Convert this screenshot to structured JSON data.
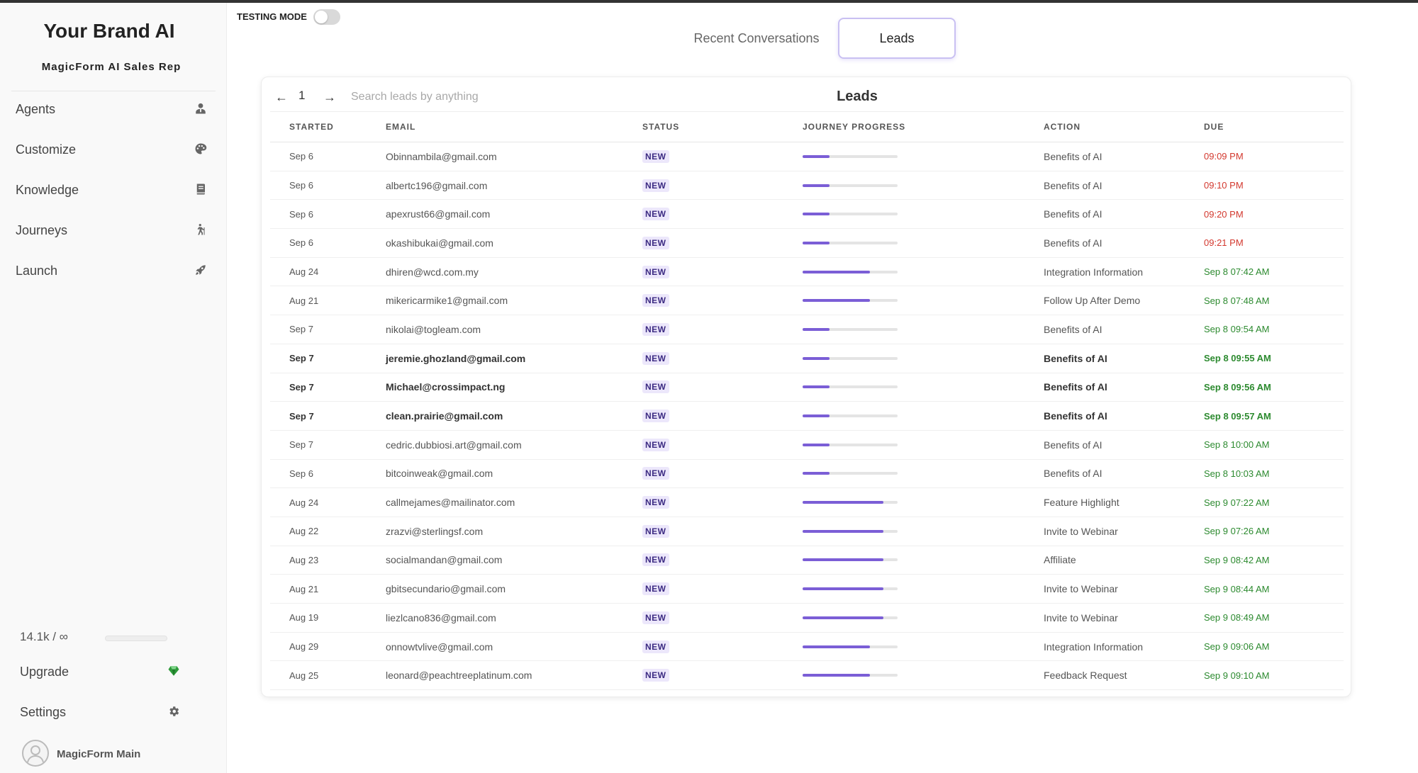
{
  "sidebar": {
    "brand": "Your Brand AI",
    "subbrand": "MagicForm AI Sales Rep",
    "nav": [
      {
        "label": "Agents",
        "icon": "person-icon"
      },
      {
        "label": "Customize",
        "icon": "palette-icon"
      },
      {
        "label": "Knowledge",
        "icon": "book-icon"
      },
      {
        "label": "Journeys",
        "icon": "hiking-icon"
      },
      {
        "label": "Launch",
        "icon": "rocket-icon"
      }
    ],
    "usage": "14.1k / ∞",
    "usage_fraction": 0.0,
    "upgrade_label": "Upgrade",
    "settings_label": "Settings",
    "account_name": "MagicForm Main"
  },
  "header": {
    "testing_mode_label": "TESTING MODE",
    "testing_mode_on": false,
    "tabs": [
      {
        "label": "Recent Conversations",
        "active": false
      },
      {
        "label": "Leads",
        "active": true
      }
    ]
  },
  "leads": {
    "title": "Leads",
    "page": "1",
    "prev_glyph": "←",
    "next_glyph": "→",
    "search_placeholder": "Search leads by anything",
    "columns": [
      "STARTED",
      "EMAIL",
      "STATUS",
      "JOURNEY PROGRESS",
      "ACTION",
      "DUE"
    ],
    "rows": [
      {
        "started": "Sep 6",
        "email": "Obinnambila@gmail.com",
        "status": "NEW",
        "progress": 0.28,
        "action": "Benefits of AI",
        "due": "09:09 PM",
        "due_state": "overdue",
        "bold": false
      },
      {
        "started": "Sep 6",
        "email": "albertc196@gmail.com",
        "status": "NEW",
        "progress": 0.28,
        "action": "Benefits of AI",
        "due": "09:10 PM",
        "due_state": "overdue",
        "bold": false
      },
      {
        "started": "Sep 6",
        "email": "apexrust66@gmail.com",
        "status": "NEW",
        "progress": 0.28,
        "action": "Benefits of AI",
        "due": "09:20 PM",
        "due_state": "overdue",
        "bold": false
      },
      {
        "started": "Sep 6",
        "email": "okashibukai@gmail.com",
        "status": "NEW",
        "progress": 0.28,
        "action": "Benefits of AI",
        "due": "09:21 PM",
        "due_state": "overdue",
        "bold": false
      },
      {
        "started": "Aug 24",
        "email": "dhiren@wcd.com.my",
        "status": "NEW",
        "progress": 0.71,
        "action": "Integration Information",
        "due": "Sep 8 07:42 AM",
        "due_state": "upcoming",
        "bold": false
      },
      {
        "started": "Aug 21",
        "email": "mikericarmike1@gmail.com",
        "status": "NEW",
        "progress": 0.71,
        "action": "Follow Up After Demo",
        "due": "Sep 8 07:48 AM",
        "due_state": "upcoming",
        "bold": false
      },
      {
        "started": "Sep 7",
        "email": "nikolai@togleam.com",
        "status": "NEW",
        "progress": 0.28,
        "action": "Benefits of AI",
        "due": "Sep 8 09:54 AM",
        "due_state": "upcoming",
        "bold": false
      },
      {
        "started": "Sep 7",
        "email": "jeremie.ghozland@gmail.com",
        "status": "NEW",
        "progress": 0.28,
        "action": "Benefits of AI",
        "due": "Sep 8 09:55 AM",
        "due_state": "upcoming",
        "bold": true
      },
      {
        "started": "Sep 7",
        "email": "Michael@crossimpact.ng",
        "status": "NEW",
        "progress": 0.28,
        "action": "Benefits of AI",
        "due": "Sep 8 09:56 AM",
        "due_state": "upcoming",
        "bold": true
      },
      {
        "started": "Sep 7",
        "email": "clean.prairie@gmail.com",
        "status": "NEW",
        "progress": 0.28,
        "action": "Benefits of AI",
        "due": "Sep 8 09:57 AM",
        "due_state": "upcoming",
        "bold": true
      },
      {
        "started": "Sep 7",
        "email": "cedric.dubbiosi.art@gmail.com",
        "status": "NEW",
        "progress": 0.28,
        "action": "Benefits of AI",
        "due": "Sep 8 10:00 AM",
        "due_state": "upcoming",
        "bold": false
      },
      {
        "started": "Sep 6",
        "email": "bitcoinweak@gmail.com",
        "status": "NEW",
        "progress": 0.28,
        "action": "Benefits of AI",
        "due": "Sep 8 10:03 AM",
        "due_state": "upcoming",
        "bold": false
      },
      {
        "started": "Aug 24",
        "email": "callmejames@mailinator.com",
        "status": "NEW",
        "progress": 0.85,
        "action": "Feature Highlight",
        "due": "Sep 9 07:22 AM",
        "due_state": "upcoming",
        "bold": false
      },
      {
        "started": "Aug 22",
        "email": "zrazvi@sterlingsf.com",
        "status": "NEW",
        "progress": 0.85,
        "action": "Invite to Webinar",
        "due": "Sep 9 07:26 AM",
        "due_state": "upcoming",
        "bold": false
      },
      {
        "started": "Aug 23",
        "email": "socialmandan@gmail.com",
        "status": "NEW",
        "progress": 0.85,
        "action": "Affiliate",
        "due": "Sep 9 08:42 AM",
        "due_state": "upcoming",
        "bold": false
      },
      {
        "started": "Aug 21",
        "email": "gbitsecundario@gmail.com",
        "status": "NEW",
        "progress": 0.85,
        "action": "Invite to Webinar",
        "due": "Sep 9 08:44 AM",
        "due_state": "upcoming",
        "bold": false
      },
      {
        "started": "Aug 19",
        "email": "liezlcano836@gmail.com",
        "status": "NEW",
        "progress": 0.85,
        "action": "Invite to Webinar",
        "due": "Sep 9 08:49 AM",
        "due_state": "upcoming",
        "bold": false
      },
      {
        "started": "Aug 29",
        "email": "onnowtvlive@gmail.com",
        "status": "NEW",
        "progress": 0.71,
        "action": "Integration Information",
        "due": "Sep 9 09:06 AM",
        "due_state": "upcoming",
        "bold": false
      },
      {
        "started": "Aug 25",
        "email": "leonard@peachtreeplatinum.com",
        "status": "NEW",
        "progress": 0.71,
        "action": "Feedback Request",
        "due": "Sep 9 09:10 AM",
        "due_state": "upcoming",
        "bold": false
      }
    ]
  },
  "colors": {
    "accent": "#7b5ed6",
    "overdue": "#d3382e",
    "upcoming": "#2c8a2f",
    "upgrade_gem": "#2e9b3a"
  }
}
